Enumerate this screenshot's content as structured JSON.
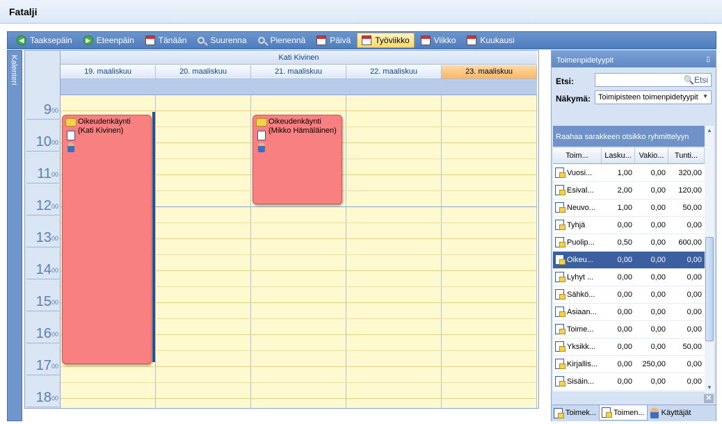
{
  "window": {
    "title": "Fatalji"
  },
  "toolbar": {
    "buttons": [
      {
        "label": "Taaksepäin",
        "icon": "back-arrow-icon"
      },
      {
        "label": "Eteenpäin",
        "icon": "forward-arrow-icon"
      },
      {
        "label": "Tänään",
        "icon": "calendar-icon"
      },
      {
        "label": "Suurenna",
        "icon": "zoom-in-icon"
      },
      {
        "label": "Pienennä",
        "icon": "zoom-out-icon"
      },
      {
        "label": "Päivä",
        "icon": "calendar-day-icon"
      },
      {
        "label": "Työviikko",
        "icon": "calendar-workweek-icon",
        "active": true
      },
      {
        "label": "Viikko",
        "icon": "calendar-week-icon"
      },
      {
        "label": "Kuukausi",
        "icon": "calendar-month-icon"
      }
    ]
  },
  "sidebar": {
    "label": "Kalenteri"
  },
  "calendar": {
    "resource": "Kati Kivinen",
    "days": [
      "19. maaliskuu",
      "20. maaliskuu",
      "21. maaliskuu",
      "22. maaliskuu",
      "23. maaliskuu"
    ],
    "today_index": 4,
    "hours": [
      "9",
      "10",
      "11",
      "12",
      "13",
      "14",
      "15",
      "16",
      "17",
      "18"
    ],
    "minutes": "00",
    "appointments": [
      {
        "line1": "Oikeudenkäynti",
        "line2": "(Kati Kivinen)",
        "day": 0,
        "start_hour": 8.75,
        "end_hour": 16.75
      },
      {
        "line1": "Oikeudenkäynti",
        "line2": "(Mikko Hämäläinen)",
        "day": 2,
        "start_hour": 8.75,
        "end_hour": 11.75
      }
    ]
  },
  "panel": {
    "title": "Toimenpidetyypit",
    "search_label": "Etsi:",
    "search_button": "Etsi",
    "view_label": "Näkymä:",
    "view_value": "Toimipisteen toimenpidetyypit",
    "group_hint": "Raahaa sarakkeen otsikko ryhmittelyyn",
    "columns": [
      "Toim...",
      "Lasku...",
      "Vakio...",
      "Tunti..."
    ],
    "rows": [
      [
        "Vuosi...",
        "1,00",
        "0,00",
        "320,00"
      ],
      [
        "Esival...",
        "2,00",
        "0,00",
        "120,00"
      ],
      [
        "Neuvo...",
        "1,00",
        "0,00",
        "50,00"
      ],
      [
        "Tyhjä",
        "0,00",
        "0,00",
        "0,00"
      ],
      [
        "Puolip...",
        "0,50",
        "0,00",
        "600,00"
      ],
      [
        "Oikeu...",
        "0,00",
        "0,00",
        "0,00"
      ],
      [
        "Lyhyt ...",
        "0,00",
        "0,00",
        "0,00"
      ],
      [
        "Sähkö...",
        "0,00",
        "0,00",
        "0,00"
      ],
      [
        "Asiaan...",
        "0,00",
        "0,00",
        "0,00"
      ],
      [
        "Toime...",
        "0,00",
        "0,00",
        "0,00"
      ],
      [
        "Yksikk...",
        "0,00",
        "0,00",
        "50,00"
      ],
      [
        "Kirjallis...",
        "0,00",
        "250,00",
        "0,00"
      ],
      [
        "Sisäin...",
        "0,00",
        "0,00",
        "0,00"
      ]
    ],
    "selected_row": 5,
    "tabs": [
      "Toimek...",
      "Toimen...",
      "Käyttäjät"
    ],
    "active_tab": 1
  }
}
